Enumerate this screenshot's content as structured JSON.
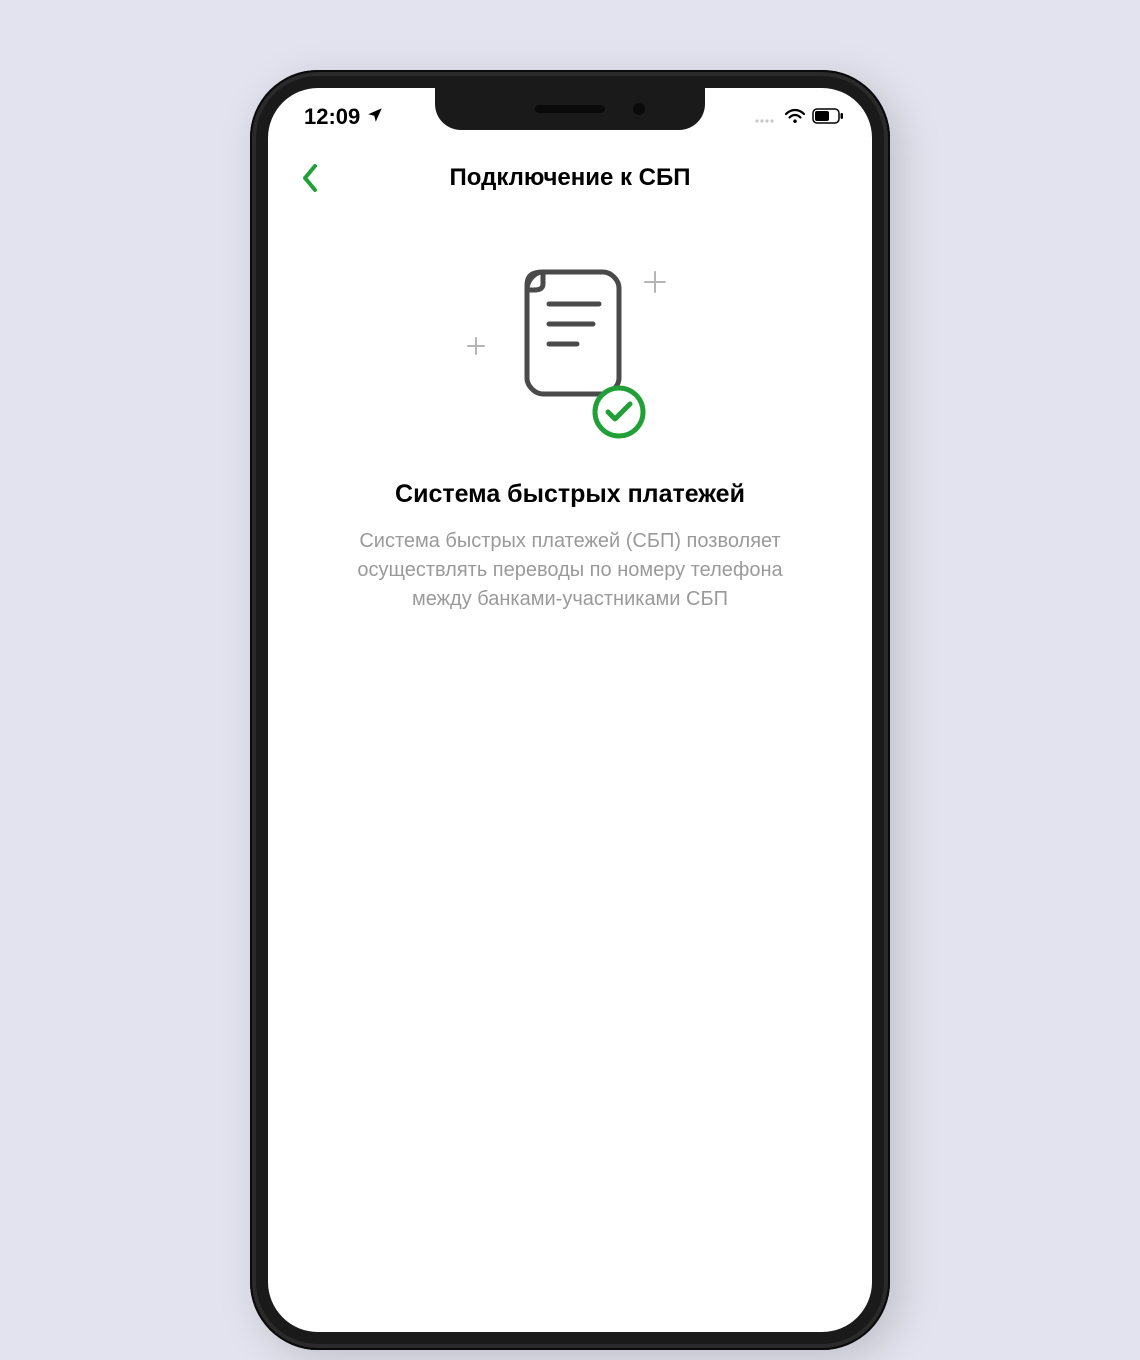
{
  "status_bar": {
    "time": "12:09"
  },
  "nav": {
    "title": "Подключение к СБП"
  },
  "content": {
    "heading": "Система быстрых платежей",
    "description": "Система быстрых платежей (СБП) позволяет осуществлять переводы по номеру телефона между банками-участниками СБП"
  },
  "colors": {
    "accent": "#21a038",
    "icon_gray": "#4a4a4a",
    "text_gray": "#9a9a9a"
  }
}
